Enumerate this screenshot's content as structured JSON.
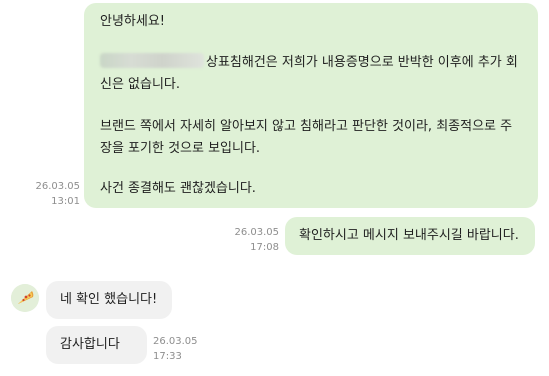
{
  "messages": {
    "main": {
      "line1": "안녕하세요!",
      "line2a": "상표침해건은 저희가 내용증명으로 반박한 이후에 추가 회",
      "line2b": "신은 없습니다.",
      "line3a": "브랜드 쪽에서 자세히 알아보지 않고 침해라고 판단한 것이라, 최종적으로 주",
      "line3b": "장을 포기한 것으로 보입니다.",
      "line4": "사건 종결해도 괜찮겠습니다.",
      "date": "26.03.05",
      "time": "13:01"
    },
    "confirm": {
      "text": "확인하시고 메시지 보내주시길 바랍니다.",
      "date": "26.03.05",
      "time": "17:08"
    },
    "yes": {
      "text": "네 확인 했습니다!"
    },
    "thanks": {
      "text": "감사합니다 :)",
      "date": "26.03.05",
      "time": "17:33"
    }
  },
  "colors": {
    "outgoing_bubble": "#dff1d6",
    "incoming_bubble": "#f1f1f1",
    "timestamp": "#8e8e8e"
  },
  "icons": {
    "avatar": "pizza-slice-icon"
  }
}
